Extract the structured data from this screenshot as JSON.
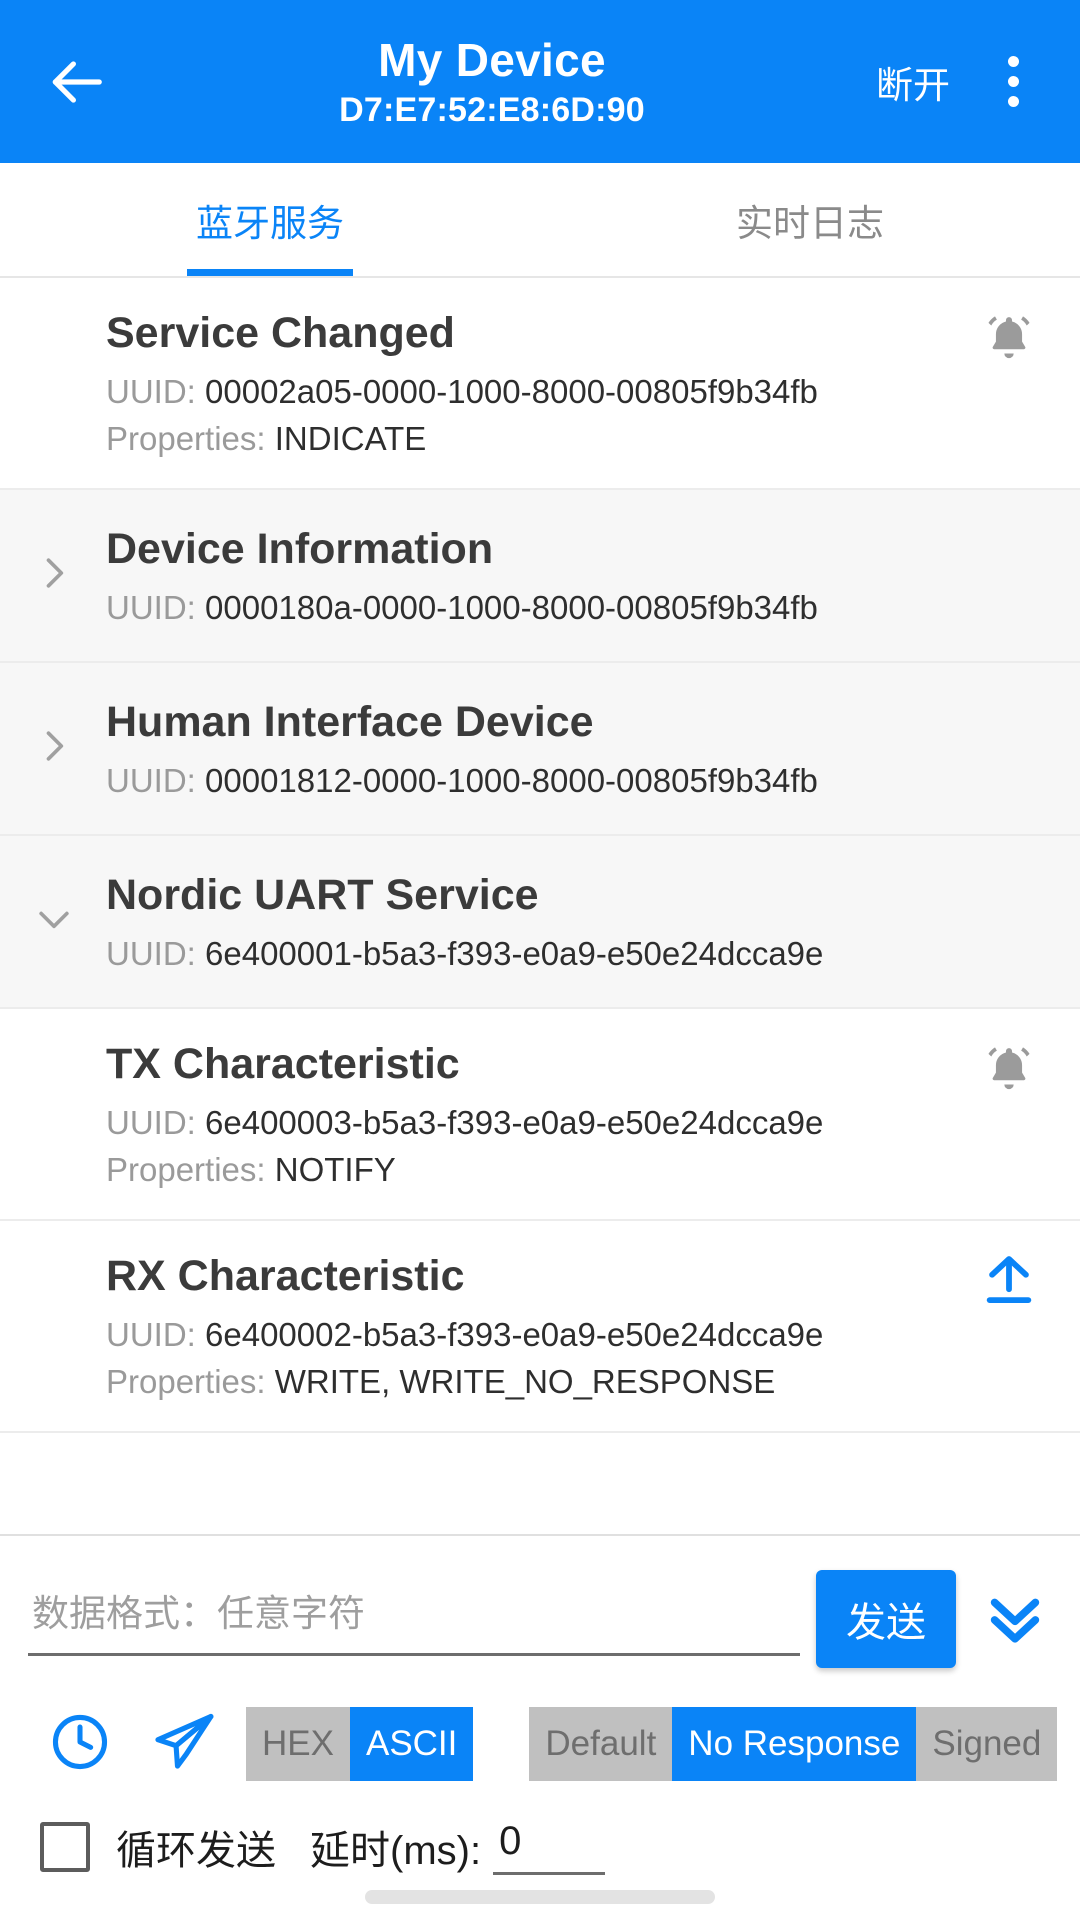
{
  "appbar": {
    "back_icon": "arrow-left-icon",
    "title": "My Device",
    "subtitle": "D7:E7:52:E8:6D:90",
    "disconnect_label": "断开",
    "overflow_icon": "more-vertical-icon",
    "background_color": "#0A84F7"
  },
  "tabs": [
    {
      "label": "蓝牙服务",
      "active": true
    },
    {
      "label": "实时日志",
      "active": false
    }
  ],
  "labels": {
    "uuid_prefix": "UUID:",
    "properties_prefix": "Properties:"
  },
  "items": [
    {
      "name": "service-changed",
      "title": "Service Changed",
      "uuid": "00002a05-0000-1000-8000-00805f9b34fb",
      "properties": "INDICATE",
      "action_icon": "bell-notify-icon",
      "chevron": "",
      "shaded": false
    },
    {
      "name": "device-information",
      "title": "Device Information",
      "uuid": "0000180a-0000-1000-8000-00805f9b34fb",
      "properties": "",
      "action_icon": "",
      "chevron": "chevron-right-icon",
      "shaded": true
    },
    {
      "name": "human-interface-device",
      "title": "Human Interface Device",
      "uuid": "00001812-0000-1000-8000-00805f9b34fb",
      "properties": "",
      "action_icon": "",
      "chevron": "chevron-right-icon",
      "shaded": true
    },
    {
      "name": "nordic-uart-service",
      "title": "Nordic UART Service",
      "uuid": "6e400001-b5a3-f393-e0a9-e50e24dcca9e",
      "properties": "",
      "action_icon": "",
      "chevron": "chevron-down-icon",
      "shaded": true
    },
    {
      "name": "tx-characteristic",
      "title": "TX Characteristic",
      "uuid": "6e400003-b5a3-f393-e0a9-e50e24dcca9e",
      "properties": "NOTIFY",
      "action_icon": "bell-notify-icon",
      "chevron": "",
      "shaded": false
    },
    {
      "name": "rx-characteristic",
      "title": "RX Characteristic",
      "uuid": "6e400002-b5a3-f393-e0a9-e50e24dcca9e",
      "properties": "WRITE, WRITE_NO_RESPONSE",
      "action_icon": "upload-icon",
      "chevron": "",
      "shaded": false
    }
  ],
  "send_panel": {
    "input_value": "",
    "input_placeholder": "数据格式：任意字符",
    "send_label": "发送",
    "expand_icon": "chevron-double-down-icon",
    "history_icon": "clock-icon",
    "quick_send_icon": "paper-plane-icon",
    "format_segments": [
      {
        "label": "HEX",
        "selected": false
      },
      {
        "label": "ASCII",
        "selected": true
      }
    ],
    "write_segments": [
      {
        "label": "Default",
        "selected": false
      },
      {
        "label": "No Response",
        "selected": true
      },
      {
        "label": "Signed",
        "selected": false
      }
    ],
    "loop_checked": false,
    "loop_label": "循环发送",
    "delay_label": "延时(ms):",
    "delay_value": "0"
  },
  "colors": {
    "accent": "#0A84F7",
    "segment_off": "#c0c0c0",
    "row_shaded": "#f7f7f7"
  }
}
